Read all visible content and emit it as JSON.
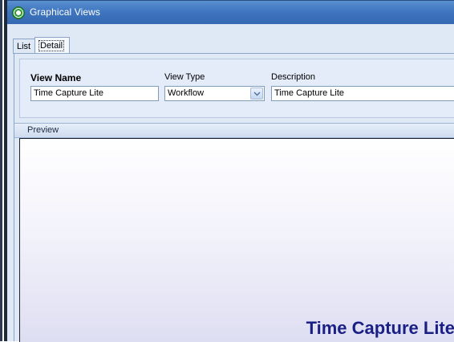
{
  "window": {
    "title": "Graphical Views"
  },
  "tabs": [
    {
      "label": "List"
    },
    {
      "label": "Detail"
    }
  ],
  "form": {
    "view_name": {
      "label": "View Name",
      "value": "Time Capture Lite"
    },
    "view_type": {
      "label": "View Type",
      "value": "Workflow"
    },
    "description": {
      "label": "Description",
      "value": "Time Capture Lite"
    }
  },
  "preview": {
    "header": "Preview",
    "title": "Time Capture Lite"
  },
  "colors": {
    "titlebar": "#3f76bf",
    "preview_title": "#1a1f86"
  },
  "icons": {
    "app": "graphical-views-icon",
    "combo": "chevron-down-icon"
  }
}
